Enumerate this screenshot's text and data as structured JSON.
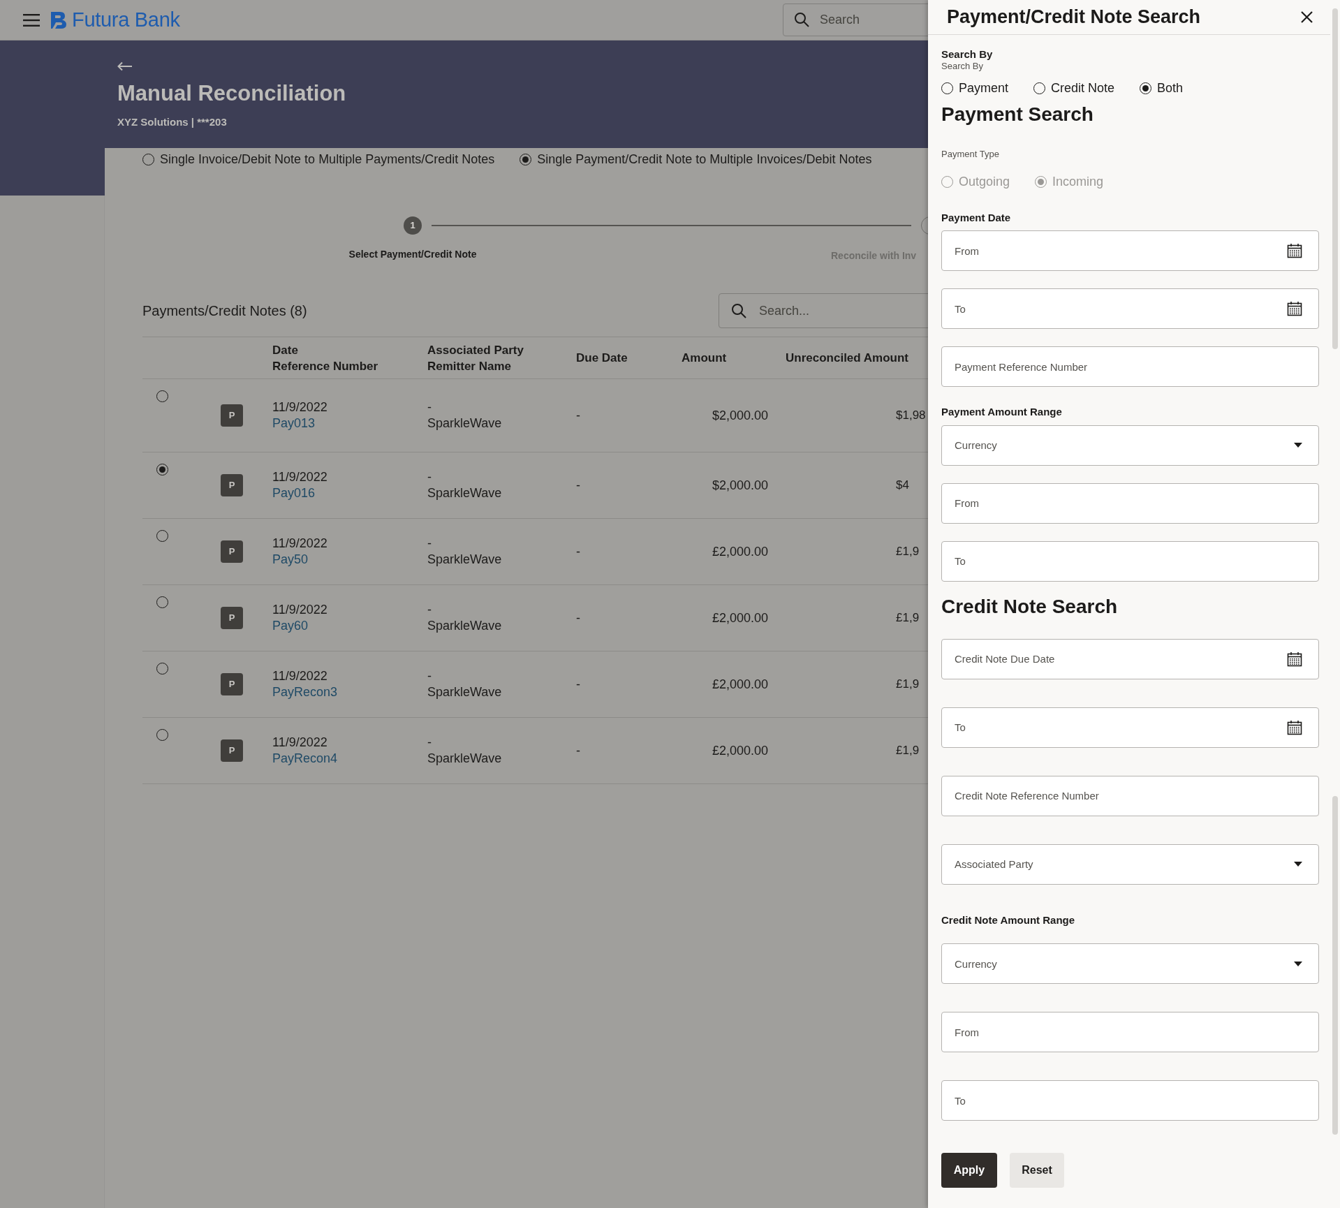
{
  "header": {
    "brand": "Futura Bank",
    "search": {
      "placeholder": "Search"
    }
  },
  "page": {
    "title": "Manual Reconciliation",
    "subtitle": "XYZ Solutions | ***203"
  },
  "modes": [
    {
      "label": "Single Invoice/Debit Note to Multiple Payments/Credit Notes",
      "selected": false
    },
    {
      "label": "Single Payment/Credit Note to Multiple Invoices/Debit Notes",
      "selected": true
    }
  ],
  "stepper": [
    {
      "number": "1",
      "label": "Select Payment/Credit Note",
      "active": true
    },
    {
      "label": "Reconcile with Inv",
      "active": false
    }
  ],
  "list": {
    "title": "Payments/Credit Notes (8)",
    "search": {
      "placeholder": "Search..."
    },
    "columns": [
      {
        "lines": [
          "Date",
          "Reference Number"
        ]
      },
      {
        "lines": [
          "Associated Party",
          "Remitter Name"
        ]
      },
      {
        "lines": [
          "Due Date"
        ]
      },
      {
        "lines": [
          "Amount"
        ]
      },
      {
        "lines": [
          "Unreconciled Amount"
        ]
      }
    ],
    "rows": [
      {
        "selected": false,
        "badge": "P",
        "date": "11/9/2022",
        "reference": "Pay013",
        "party": "-",
        "remitter": "SparkleWave",
        "due_date": "-",
        "amount": "$2,000.00",
        "unreconciled": "$1,98"
      },
      {
        "selected": true,
        "badge": "P",
        "date": "11/9/2022",
        "reference": "Pay016",
        "party": "-",
        "remitter": "SparkleWave",
        "due_date": "-",
        "amount": "$2,000.00",
        "unreconciled": "$4"
      },
      {
        "selected": false,
        "badge": "P",
        "date": "11/9/2022",
        "reference": "Pay50",
        "party": "-",
        "remitter": "SparkleWave",
        "due_date": "-",
        "amount": "£2,000.00",
        "unreconciled": "£1,9"
      },
      {
        "selected": false,
        "badge": "P",
        "date": "11/9/2022",
        "reference": "Pay60",
        "party": "-",
        "remitter": "SparkleWave",
        "due_date": "-",
        "amount": "£2,000.00",
        "unreconciled": "£1,9"
      },
      {
        "selected": false,
        "badge": "P",
        "date": "11/9/2022",
        "reference": "PayRecon3",
        "party": "-",
        "remitter": "SparkleWave",
        "due_date": "-",
        "amount": "£2,000.00",
        "unreconciled": "£1,9"
      },
      {
        "selected": false,
        "badge": "P",
        "date": "11/9/2022",
        "reference": "PayRecon4",
        "party": "-",
        "remitter": "SparkleWave",
        "due_date": "-",
        "amount": "£2,000.00",
        "unreconciled": "£1,9"
      }
    ]
  },
  "drawer": {
    "title": "Payment/Credit Note Search",
    "search_by": {
      "label": "Search By",
      "sublabel": "Search By",
      "options": [
        {
          "label": "Payment",
          "selected": false
        },
        {
          "label": "Credit Note",
          "selected": false
        },
        {
          "label": "Both",
          "selected": true
        }
      ]
    },
    "sections": [
      {
        "heading": "Payment Search",
        "items": [
          {
            "kind": "radios",
            "label": "Payment Type",
            "disabled": true,
            "options": [
              {
                "label": "Outgoing",
                "selected": false
              },
              {
                "label": "Incoming",
                "selected": true
              }
            ]
          },
          {
            "kind": "label",
            "text": "Payment Date"
          },
          {
            "kind": "date",
            "placeholder": "From"
          },
          {
            "kind": "date",
            "placeholder": "To"
          },
          {
            "kind": "text",
            "placeholder": "Payment Reference Number"
          },
          {
            "kind": "label",
            "text": "Payment Amount Range"
          },
          {
            "kind": "select",
            "placeholder": "Currency"
          },
          {
            "kind": "text",
            "placeholder": "From"
          },
          {
            "kind": "text",
            "placeholder": "To"
          }
        ]
      },
      {
        "heading": "Credit Note Search",
        "items": [
          {
            "kind": "date",
            "placeholder": "Credit Note Due Date"
          },
          {
            "kind": "date",
            "placeholder": "To"
          },
          {
            "kind": "text",
            "placeholder": "Credit Note Reference Number"
          },
          {
            "kind": "select",
            "placeholder": "Associated Party"
          },
          {
            "kind": "label",
            "text": "Credit Note Amount Range"
          },
          {
            "kind": "select",
            "placeholder": "Currency"
          },
          {
            "kind": "text",
            "placeholder": "From"
          },
          {
            "kind": "text",
            "placeholder": "To"
          }
        ]
      }
    ],
    "buttons": [
      {
        "label": "Apply",
        "primary": true
      },
      {
        "label": "Reset",
        "primary": false
      }
    ]
  }
}
